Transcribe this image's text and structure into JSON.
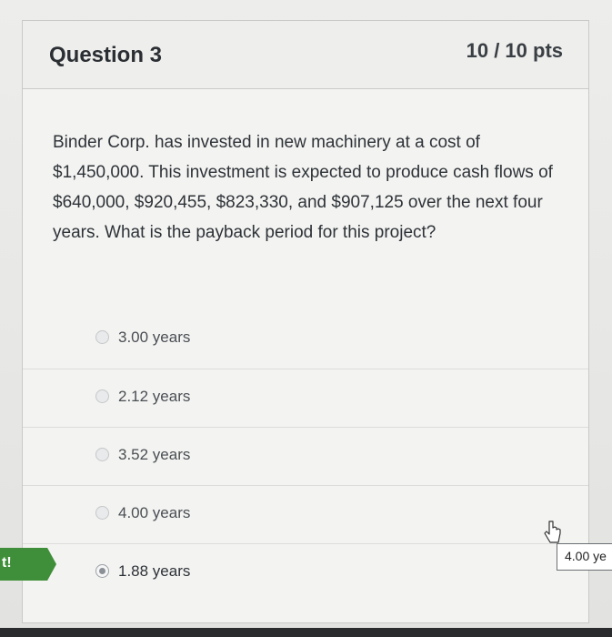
{
  "question": {
    "title": "Question 3",
    "points": "10 / 10 pts",
    "text": "Binder Corp. has invested in new machinery at a cost of $1,450,000. This investment is expected to produce cash flows of $640,000, $920,455, $823,330, and $907,125 over the next four years. What is the payback period for this project?"
  },
  "answers": [
    {
      "label": "3.00 years",
      "selected": false
    },
    {
      "label": "2.12 years",
      "selected": false
    },
    {
      "label": "3.52 years",
      "selected": false
    },
    {
      "label": "4.00 years",
      "selected": false
    },
    {
      "label": "1.88 years",
      "selected": true
    }
  ],
  "correct_tag": {
    "text": "t!",
    "color": "#3f8f3a"
  },
  "tooltip": {
    "text": "4.00 ye"
  },
  "icons": {
    "cursor": "pointer-cursor-icon"
  }
}
